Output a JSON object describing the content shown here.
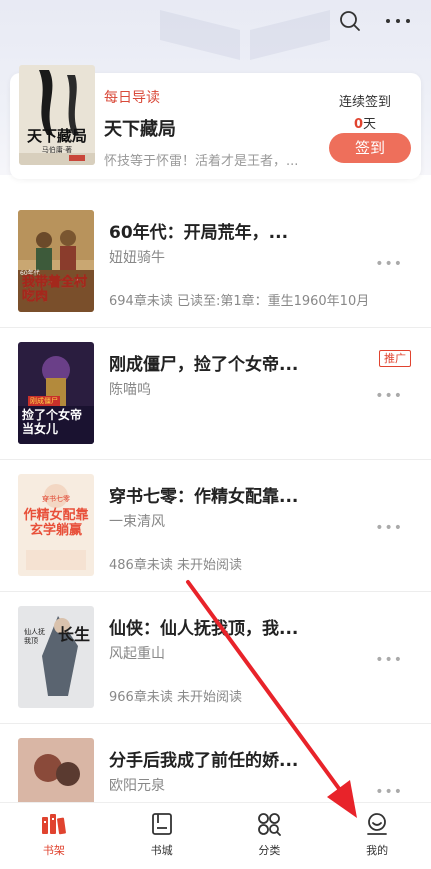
{
  "header": {
    "search_icon": "search-icon",
    "more_icon": "more-icon"
  },
  "daily": {
    "tag": "每日导读",
    "title": "天下藏局",
    "description": "怀技等于怀雷！活着才是王者，...",
    "cover_text": "天下藏局",
    "cover_subtext": "马伯庸·著"
  },
  "checkin": {
    "label": "连续签到",
    "days": "0",
    "days_unit": "天",
    "button": "签到"
  },
  "books": [
    {
      "title": "60年代：开局荒年，...",
      "author": "妞妞骑牛",
      "progress": "694章未读 已读至:第1章：重生1960年10月",
      "badge": "",
      "cover_text": "我带着全村吃肉",
      "cover_subtext": "60年代"
    },
    {
      "title": "刚成僵尸，捡了个女帝...",
      "author": "陈喵呜",
      "progress": "",
      "badge": "推广",
      "cover_text": "捡了个女帝当女儿",
      "cover_subtext": "刚成僵尸"
    },
    {
      "title": "穿书七零：作精女配靠...",
      "author": "一束清风",
      "progress": "486章未读 未开始阅读",
      "badge": "",
      "cover_text": "作精女配靠玄学躺赢",
      "cover_subtext": "穿书七零"
    },
    {
      "title": "仙侠：仙人抚我顶，我...",
      "author": "风起重山",
      "progress": "966章未读 未开始阅读",
      "badge": "",
      "cover_text": "长生",
      "cover_subtext": "仙人抚我顶"
    },
    {
      "title": "分手后我成了前任的娇...",
      "author": "欧阳元泉",
      "progress": "",
      "badge": "",
      "cover_text": "",
      "cover_subtext": ""
    }
  ],
  "nav": {
    "items": [
      {
        "label": "书架",
        "icon": "bookshelf-icon",
        "active": true
      },
      {
        "label": "书城",
        "icon": "bookstore-icon",
        "active": false
      },
      {
        "label": "分类",
        "icon": "category-icon",
        "active": false
      },
      {
        "label": "我的",
        "icon": "profile-icon",
        "active": false
      }
    ]
  },
  "colors": {
    "accent": "#e0432f",
    "checkin_button": "#ee6f5b",
    "annotation_arrow": "#e8232a"
  }
}
